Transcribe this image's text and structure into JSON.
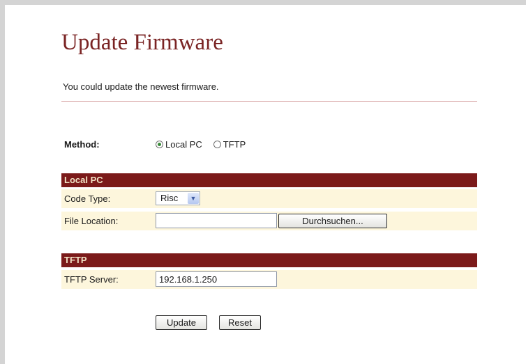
{
  "page": {
    "title": "Update Firmware",
    "subtitle": "You could update the newest firmware."
  },
  "method": {
    "label": "Method:",
    "options": [
      {
        "label": "Local PC",
        "selected": true
      },
      {
        "label": "TFTP",
        "selected": false
      }
    ]
  },
  "local_pc": {
    "header": "Local PC",
    "code_type_label": "Code Type:",
    "code_type_value": "Risc",
    "file_location_label": "File Location:",
    "file_location_value": "",
    "browse_button": "Durchsuchen..."
  },
  "tftp": {
    "header": "TFTP",
    "server_label": "TFTP Server:",
    "server_value": "192.168.1.250"
  },
  "actions": {
    "update": "Update",
    "reset": "Reset"
  },
  "colors": {
    "title": "#7a2424",
    "section_header_bg": "#7b1a1a",
    "section_header_text": "#f1e2c5",
    "row_bg": "#fdf6dc",
    "divider": "#d9a7a7"
  }
}
